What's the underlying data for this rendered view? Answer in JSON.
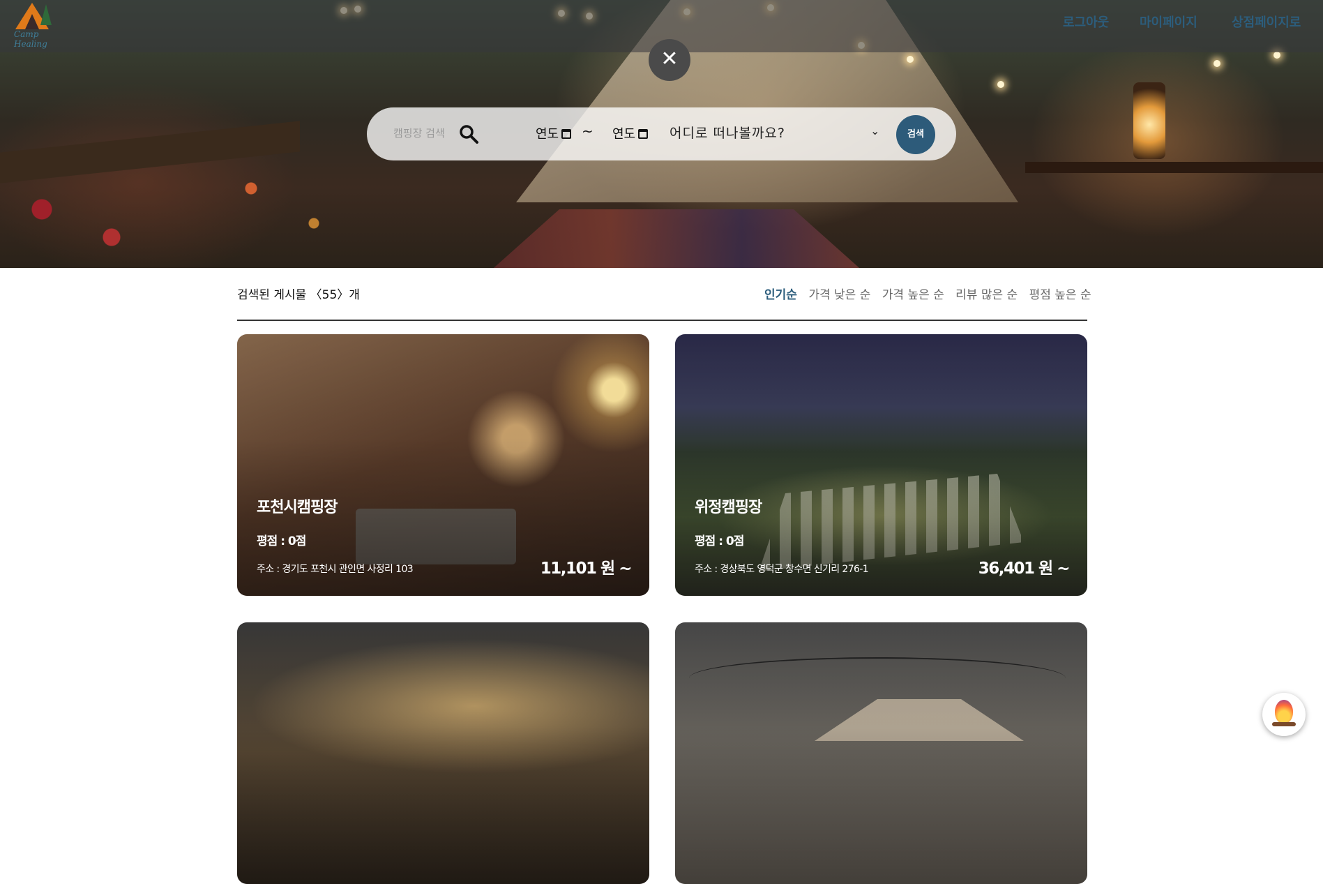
{
  "nav": {
    "logo_text": "Camp Healing",
    "logout": "로그아웃",
    "mypage": "마이페이지",
    "store": "상점페이지로"
  },
  "search": {
    "keyword_placeholder": "캠핑장 검색",
    "date_start": "연도",
    "date_end": "연도",
    "range_sep": "~",
    "destination_placeholder": "어디로 떠나볼까요?",
    "submit": "검색",
    "close": "✕"
  },
  "results": {
    "count_prefix": "검색된 게시물 ",
    "count_open": "〈",
    "count": "55",
    "count_close": "〉",
    "count_suffix": "개",
    "sort_options": [
      "인기순",
      "가격 낮은 순",
      "가격 높은 순",
      "리뷰 많은 순",
      "평점 높은 순"
    ],
    "active_sort": "인기순"
  },
  "cards": [
    {
      "name": "포천시캠핑장",
      "rating": "평점 : 0점",
      "address": "주소 : 경기도 포천시 관인면 사정리 103",
      "price": "11,101 원 ~"
    },
    {
      "name": "위정캠핑장",
      "rating": "평점 : 0점",
      "address": "주소 : 경상북도 영덕군 창수면 신기리 276-1",
      "price": "36,401 원 ~"
    },
    {
      "name": "",
      "rating": "",
      "address": "",
      "price": ""
    },
    {
      "name": "",
      "rating": "",
      "address": "",
      "price": ""
    }
  ],
  "colors": {
    "accent": "#2d5b7a",
    "nav_text": "#2c5d7c",
    "topbar": "#37373c"
  },
  "icons": {
    "close": "close-icon",
    "search": "search-icon",
    "calendar": "calendar-icon",
    "chevron": "chevron-down-icon",
    "chatbot": "campfire-icon"
  }
}
